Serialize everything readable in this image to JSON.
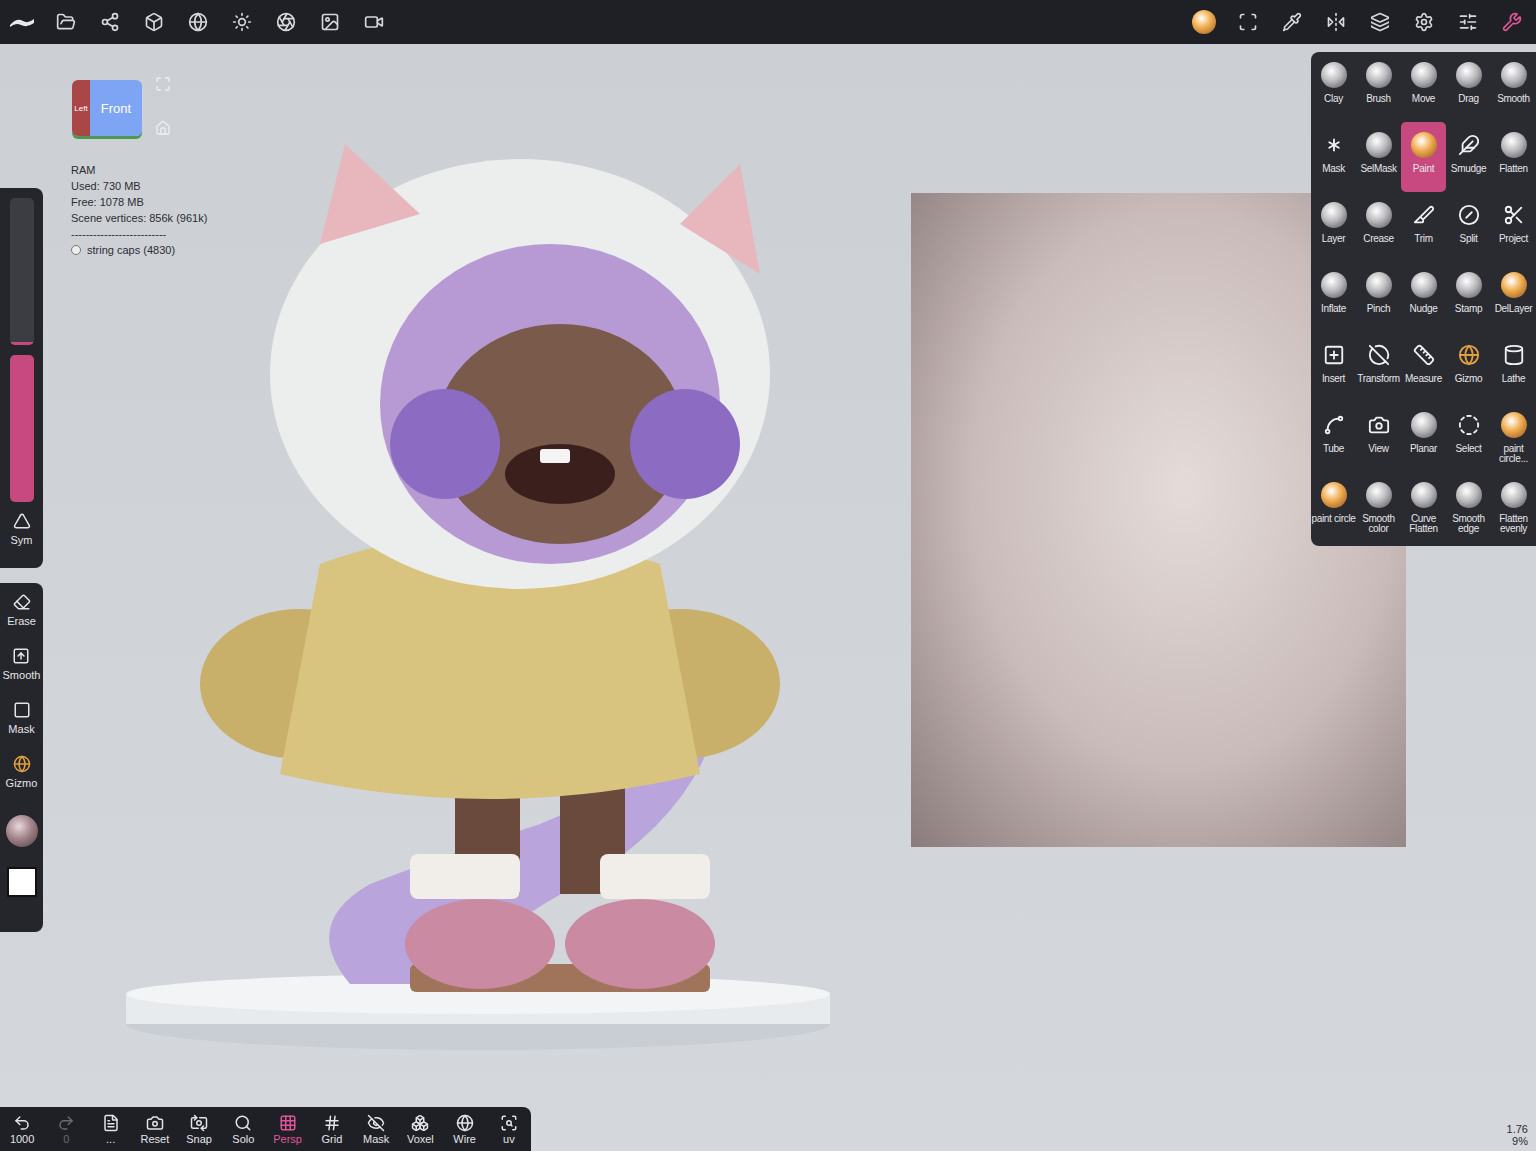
{
  "top_bar": {
    "tools_open": true
  },
  "view_cube": {
    "front": "Front",
    "left": "Left"
  },
  "stats": [
    "RAM",
    "Used: 730 MB",
    "Free: 1078 MB",
    "Scene vertices: 856k (961k)",
    "--------------------------"
  ],
  "scene_object": "string caps (4830)",
  "left_sliders": [
    {
      "level": 0.02
    },
    {
      "level": 1.0
    }
  ],
  "sym": {
    "label": "Sym"
  },
  "side_tools": [
    {
      "label": "Erase"
    },
    {
      "label": "Smooth"
    },
    {
      "label": "Mask"
    },
    {
      "label": "Gizmo"
    }
  ],
  "material": {
    "color": "#a3848c"
  },
  "paint_color": {
    "color": "#ffffff"
  },
  "tools": [
    {
      "label": "Clay",
      "kind": "sphere",
      "selected": false
    },
    {
      "label": "Brush",
      "kind": "sphere",
      "selected": false
    },
    {
      "label": "Move",
      "kind": "sphere",
      "selected": false
    },
    {
      "label": "Drag",
      "kind": "sphere",
      "selected": false
    },
    {
      "label": "Smooth",
      "kind": "sphere",
      "selected": false
    },
    {
      "label": "Mask",
      "kind": "line",
      "selected": false
    },
    {
      "label": "SelMask",
      "kind": "sphere",
      "selected": false
    },
    {
      "label": "Paint",
      "kind": "paint",
      "selected": true
    },
    {
      "label": "Smudge",
      "kind": "line",
      "selected": false
    },
    {
      "label": "Flatten",
      "kind": "sphere",
      "selected": false
    },
    {
      "label": "Layer",
      "kind": "sphere",
      "selected": false
    },
    {
      "label": "Crease",
      "kind": "sphere",
      "selected": false
    },
    {
      "label": "Trim",
      "kind": "line",
      "selected": false
    },
    {
      "label": "Split",
      "kind": "line",
      "selected": false
    },
    {
      "label": "Project",
      "kind": "line",
      "selected": false
    },
    {
      "label": "Inflate",
      "kind": "sphere",
      "selected": false
    },
    {
      "label": "Pinch",
      "kind": "sphere",
      "selected": false
    },
    {
      "label": "Nudge",
      "kind": "sphere",
      "selected": false
    },
    {
      "label": "Stamp",
      "kind": "sphere",
      "selected": false
    },
    {
      "label": "DelLayer",
      "kind": "paint",
      "selected": false
    },
    {
      "label": "Insert",
      "kind": "line",
      "selected": false
    },
    {
      "label": "Transform",
      "kind": "line",
      "selected": false
    },
    {
      "label": "Measure",
      "kind": "line",
      "selected": false
    },
    {
      "label": "Gizmo",
      "kind": "line",
      "selected": false
    },
    {
      "label": "Lathe",
      "kind": "line",
      "selected": false
    },
    {
      "label": "Tube",
      "kind": "line",
      "selected": false
    },
    {
      "label": "View",
      "kind": "line",
      "selected": false
    },
    {
      "label": "Planar",
      "kind": "sphere",
      "selected": false
    },
    {
      "label": "Select",
      "kind": "line",
      "selected": false
    },
    {
      "label": "paint circle...",
      "kind": "paint",
      "selected": false
    },
    {
      "label": "paint circle",
      "kind": "paint",
      "selected": false
    },
    {
      "label": "Smooth color",
      "kind": "sphere",
      "selected": false
    },
    {
      "label": "Curve Flatten",
      "kind": "sphere",
      "selected": false
    },
    {
      "label": "Smooth edge",
      "kind": "sphere",
      "selected": false
    },
    {
      "label": "Flatten evenly",
      "kind": "sphere",
      "selected": false
    }
  ],
  "bottom_bar": [
    {
      "label": "1000",
      "active": false,
      "disabled": false
    },
    {
      "label": "0",
      "active": false,
      "disabled": true
    },
    {
      "label": "...",
      "active": false,
      "disabled": false
    },
    {
      "label": "Reset",
      "active": false,
      "disabled": false
    },
    {
      "label": "Snap",
      "active": false,
      "disabled": false
    },
    {
      "label": "Solo",
      "active": false,
      "disabled": false
    },
    {
      "label": "Persp",
      "active": true,
      "disabled": false
    },
    {
      "label": "Grid",
      "active": false,
      "disabled": false
    },
    {
      "label": "Mask",
      "active": false,
      "disabled": false
    },
    {
      "label": "Voxel",
      "active": false,
      "disabled": false
    },
    {
      "label": "Wire",
      "active": false,
      "disabled": false
    },
    {
      "label": "uv",
      "active": false,
      "disabled": false
    }
  ],
  "zoom": {
    "value": "1.76",
    "percent": "9%"
  }
}
